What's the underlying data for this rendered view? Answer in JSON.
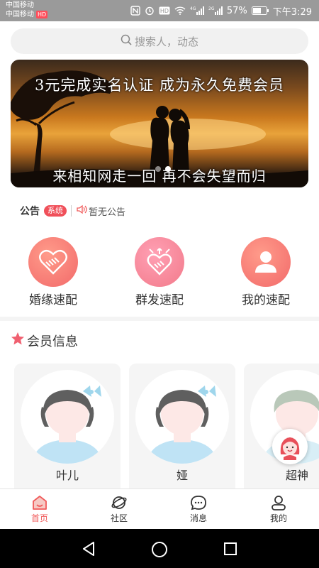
{
  "status_bar": {
    "carrier_1": "中国移动",
    "carrier_2": "中国移动",
    "hd_badge": "HD",
    "battery": "57%",
    "time": "下午3:29",
    "signal_1": "4G",
    "signal_2": "2G"
  },
  "search": {
    "placeholder": "搜索人，动态"
  },
  "banner": {
    "line1": "3元完成实名认证   成为永久免费会员",
    "line2": "来相知网走一回   再不会失望而归",
    "slide_count": 2,
    "active_slide": 1
  },
  "notice": {
    "title": "公告",
    "tag": "系统",
    "text": "暂无公告"
  },
  "quick_match": [
    {
      "label": "婚缘速配",
      "icon": "handshake-heart-icon",
      "color": "#f26a6a"
    },
    {
      "label": "群发速配",
      "icon": "group-send-heart-icon",
      "color": "#f27a8a"
    },
    {
      "label": "我的速配",
      "icon": "user-icon",
      "color": "#f26a6a"
    }
  ],
  "members": {
    "title": "会员信息",
    "items": [
      {
        "name": "叶儿"
      },
      {
        "name": "娅"
      },
      {
        "name": "超神"
      }
    ]
  },
  "tabbar": {
    "items": [
      {
        "label": "首页",
        "icon": "home-icon",
        "active": true
      },
      {
        "label": "社区",
        "icon": "planet-icon",
        "active": false
      },
      {
        "label": "消息",
        "icon": "chat-icon",
        "active": false
      },
      {
        "label": "我的",
        "icon": "profile-icon",
        "active": false
      }
    ]
  },
  "colors": {
    "accent": "#f05a5a",
    "status_bar": "#9a9a9a"
  }
}
